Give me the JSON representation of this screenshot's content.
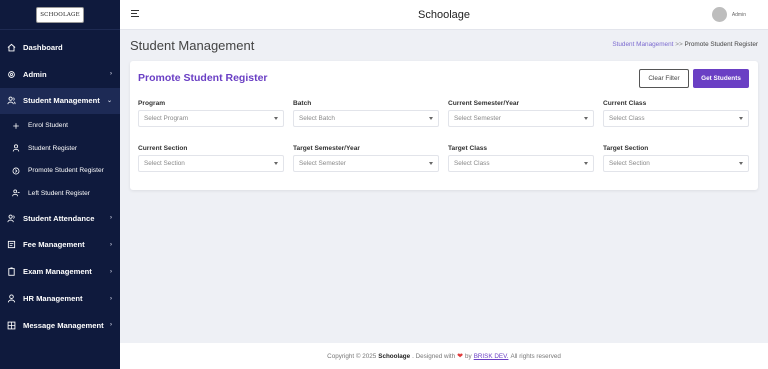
{
  "sidebar": {
    "logo_text": "SCHOOLAGE",
    "items": [
      {
        "label": "Dashboard",
        "icon": "home-icon",
        "chevron": ""
      },
      {
        "label": "Admin",
        "icon": "gear-icon",
        "chevron": "›"
      },
      {
        "label": "Student Management",
        "icon": "users-icon",
        "chevron": "⌄"
      },
      {
        "label": "Student Attendance",
        "icon": "users-icon",
        "chevron": "›"
      },
      {
        "label": "Fee Management",
        "icon": "receipt-icon",
        "chevron": "›"
      },
      {
        "label": "Exam Management",
        "icon": "clipboard-icon",
        "chevron": "›"
      },
      {
        "label": "HR Management",
        "icon": "user-icon",
        "chevron": "›"
      },
      {
        "label": "Message Management",
        "icon": "grid-icon",
        "chevron": "›"
      }
    ],
    "sub_items": [
      {
        "label": "Enrol Student",
        "icon": "plus-icon"
      },
      {
        "label": "Student Register",
        "icon": "user-icon"
      },
      {
        "label": "Promote Student Register",
        "icon": "circle-arrow-icon"
      },
      {
        "label": "Left Student Register",
        "icon": "user-minus-icon"
      }
    ]
  },
  "topbar": {
    "title": "Schoolage",
    "user_name": "Admin"
  },
  "page": {
    "title": "Student Management",
    "breadcrumb_link": "Student Management",
    "breadcrumb_sep": ">>",
    "breadcrumb_current": "Promote Student Register"
  },
  "card": {
    "title": "Promote Student Register",
    "clear_button": "Clear Filter",
    "get_button": "Get Students",
    "fields": [
      {
        "label": "Program",
        "placeholder": "Select Program"
      },
      {
        "label": "Batch",
        "placeholder": "Select Batch"
      },
      {
        "label": "Current Semester/Year",
        "placeholder": "Select Semester"
      },
      {
        "label": "Current Class",
        "placeholder": "Select Class"
      },
      {
        "label": "Current Section",
        "placeholder": "Select Section"
      },
      {
        "label": "Target Semester/Year",
        "placeholder": "Select Semester"
      },
      {
        "label": "Target Class",
        "placeholder": "Select Class"
      },
      {
        "label": "Target Section",
        "placeholder": "Select Section"
      }
    ]
  },
  "footer": {
    "prefix": "Copyright © 2025",
    "brand_name": "Schoolage",
    "designed_with": ". Designed with",
    "by": "by",
    "dev": "BRISK DEV.",
    "suffix": "All rights reserved"
  },
  "colors": {
    "sidebar_bg": "#0f1a3d",
    "accent": "#6a3fc4",
    "heart": "#e03a3a"
  }
}
